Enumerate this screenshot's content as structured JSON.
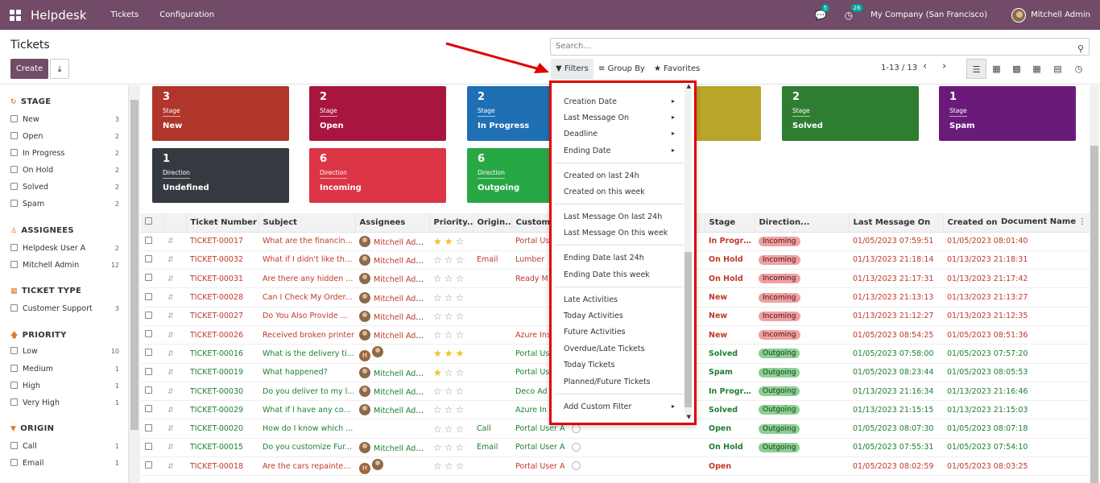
{
  "topbar": {
    "app_title": "Helpdesk",
    "menu": [
      "Tickets",
      "Configuration"
    ],
    "chat_badge": "5",
    "activity_badge": "26",
    "company": "My Company (San Francisco)",
    "user": "Mitchell Admin"
  },
  "control_panel": {
    "title": "Tickets",
    "create_label": "Create",
    "search_placeholder": "Search...",
    "filters_label": "Filters",
    "group_by_label": "Group By",
    "favorites_label": "Favorites",
    "pager": "1-13 / 13"
  },
  "sidebar": {
    "sections": [
      {
        "title": "STAGE",
        "icon": "refresh-icon",
        "items": [
          {
            "label": "New",
            "count": "3"
          },
          {
            "label": "Open",
            "count": "2"
          },
          {
            "label": "In Progress",
            "count": "2"
          },
          {
            "label": "On Hold",
            "count": "2"
          },
          {
            "label": "Solved",
            "count": "2"
          },
          {
            "label": "Spam",
            "count": "2"
          }
        ]
      },
      {
        "title": "ASSIGNEES",
        "icon": "user-icon",
        "items": [
          {
            "label": "Helpdesk User A",
            "count": "2"
          },
          {
            "label": "Mitchell Admin",
            "count": "12"
          }
        ]
      },
      {
        "title": "TICKET TYPE",
        "icon": "grid-icon",
        "items": [
          {
            "label": "Customer Support",
            "count": "3"
          }
        ]
      },
      {
        "title": "PRIORITY",
        "icon": "arrow-up-icon",
        "items": [
          {
            "label": "Low",
            "count": "10"
          },
          {
            "label": "Medium",
            "count": "1"
          },
          {
            "label": "High",
            "count": "1"
          },
          {
            "label": "Very High",
            "count": "1"
          }
        ]
      },
      {
        "title": "ORIGIN",
        "icon": "filter-icon",
        "items": [
          {
            "label": "Call",
            "count": "1"
          },
          {
            "label": "Email",
            "count": "1"
          }
        ]
      }
    ]
  },
  "cards": [
    {
      "count": "3",
      "type": "Stage",
      "value": "New",
      "color": "#b0352a"
    },
    {
      "count": "2",
      "type": "Stage",
      "value": "Open",
      "color": "#a8163f"
    },
    {
      "count": "2",
      "type": "Stage",
      "value": "In Progress",
      "color": "#1f6fb5"
    },
    {
      "count": "",
      "type": "",
      "value": "",
      "color": "#b8a52a"
    },
    {
      "count": "2",
      "type": "Stage",
      "value": "Solved",
      "color": "#2e7d32"
    },
    {
      "count": "1",
      "type": "Stage",
      "value": "Spam",
      "color": "#6a1b7a"
    },
    {
      "count": "1",
      "type": "Direction",
      "value": "Undefined",
      "color": "#343a40"
    },
    {
      "count": "6",
      "type": "Direction",
      "value": "Incoming",
      "color": "#dc3545"
    },
    {
      "count": "6",
      "type": "Direction",
      "value": "Outgoing",
      "color": "#28a745"
    }
  ],
  "table": {
    "headers": [
      "Ticket Number",
      "Subject",
      "Assignees",
      "Priority...",
      "Origin...",
      "Custome",
      "",
      "Stage",
      "Direction...",
      "Last Message On",
      "Created on",
      "Document Name"
    ],
    "rows": [
      {
        "num": "TICKET-00017",
        "subject": "What are the financin...",
        "assignee": "Mitchell Admin",
        "stars": 2,
        "origin": "",
        "customer": "Portal Us",
        "stage": "In Progress",
        "dir": "Incoming",
        "last": "01/05/2023 07:59:51",
        "created": "01/05/2023 08:01:40",
        "tone": "r"
      },
      {
        "num": "TICKET-00032",
        "subject": "What if I didn't like the...",
        "assignee": "Mitchell Admin",
        "stars": 0,
        "origin": "Email",
        "customer": "Lumber",
        "stage": "On Hold",
        "dir": "Incoming",
        "last": "01/13/2023 21:18:14",
        "created": "01/13/2023 21:18:31",
        "tone": "r"
      },
      {
        "num": "TICKET-00031",
        "subject": "Are there any hidden ...",
        "assignee": "Mitchell Admin",
        "stars": 0,
        "origin": "",
        "customer": "Ready M",
        "stage": "On Hold",
        "dir": "Incoming",
        "last": "01/13/2023 21:17:31",
        "created": "01/13/2023 21:17:42",
        "tone": "r"
      },
      {
        "num": "TICKET-00028",
        "subject": "Can I Check My Order...",
        "assignee": "Mitchell Admin",
        "stars": 0,
        "origin": "",
        "customer": "",
        "stage": "New",
        "dir": "Incoming",
        "last": "01/13/2023 21:13:13",
        "created": "01/13/2023 21:13:27",
        "tone": "r"
      },
      {
        "num": "TICKET-00027",
        "subject": "Do You Also Provide ...",
        "assignee": "Mitchell Admin",
        "stars": 0,
        "origin": "",
        "customer": "",
        "stage": "New",
        "dir": "Incoming",
        "last": "01/13/2023 21:12:27",
        "created": "01/13/2023 21:12:35",
        "tone": "r"
      },
      {
        "num": "TICKET-00026",
        "subject": "Received broken printer",
        "assignee": "Mitchell Admin",
        "stars": 0,
        "origin": "",
        "customer": "Azure Ins",
        "stage": "New",
        "dir": "Incoming",
        "last": "01/05/2023 08:54:25",
        "created": "01/05/2023 08:51:36",
        "tone": "r"
      },
      {
        "num": "TICKET-00016",
        "subject": "What is the delivery ti...",
        "assignee": "",
        "stars": 3,
        "origin": "",
        "customer": "Portal Us",
        "stage": "Solved",
        "dir": "Outgoing",
        "last": "01/05/2023 07:58:00",
        "created": "01/05/2023 07:57:20",
        "tone": "g"
      },
      {
        "num": "TICKET-00019",
        "subject": "What happened?",
        "assignee": "Mitchell Admin",
        "stars": 1,
        "origin": "",
        "customer": "Portal Us",
        "stage": "Spam",
        "dir": "Outgoing",
        "last": "01/05/2023 08:23:44",
        "created": "01/05/2023 08:05:53",
        "tone": "g"
      },
      {
        "num": "TICKET-00030",
        "subject": "Do you deliver to my l...",
        "assignee": "Mitchell Admin",
        "stars": 0,
        "origin": "",
        "customer": "Deco Ad",
        "stage": "In Progress",
        "dir": "Outgoing",
        "last": "01/13/2023 21:16:34",
        "created": "01/13/2023 21:16:46",
        "tone": "g"
      },
      {
        "num": "TICKET-00029",
        "subject": "What if I have any co...",
        "assignee": "Mitchell Admin",
        "stars": 0,
        "origin": "",
        "customer": "Azure In",
        "stage": "Solved",
        "dir": "Outgoing",
        "last": "01/13/2023 21:15:15",
        "created": "01/13/2023 21:15:03",
        "tone": "g"
      },
      {
        "num": "TICKET-00020",
        "subject": "How do I know which ...",
        "assignee": "",
        "stars": 0,
        "origin": "Call",
        "customer": "Portal User A",
        "stage": "Open",
        "dir": "Outgoing",
        "last": "01/05/2023 08:07:30",
        "created": "01/05/2023 08:07:18",
        "tone": "g"
      },
      {
        "num": "TICKET-00015",
        "subject": "Do you customize Fur...",
        "assignee": "Mitchell Admin",
        "stars": 0,
        "origin": "Email",
        "customer": "Portal User A",
        "stage": "On Hold",
        "dir": "Outgoing",
        "last": "01/05/2023 07:55:31",
        "created": "01/05/2023 07:54:10",
        "tone": "g"
      },
      {
        "num": "TICKET-00018",
        "subject": "Are the cars repainted...",
        "assignee": "",
        "stars": 0,
        "origin": "",
        "customer": "Portal User A",
        "stage": "Open",
        "dir": "",
        "last": "01/05/2023 08:02:59",
        "created": "01/05/2023 08:03:25",
        "tone": "r"
      }
    ]
  },
  "filters_dropdown": {
    "groups": [
      [
        "Creation Date",
        "Last Message On",
        "Deadline",
        "Ending Date"
      ],
      [
        "Created on last 24h",
        "Created on this week"
      ],
      [
        "Last Message On last 24h",
        "Last Message On this week"
      ],
      [
        "Ending Date last 24h",
        "Ending Date this week"
      ],
      [
        "Late Activities",
        "Today Activities",
        "Future Activities",
        "Overdue/Late Tickets",
        "Today Tickets",
        "Planned/Future Tickets"
      ],
      [
        "Add Custom Filter"
      ]
    ]
  }
}
